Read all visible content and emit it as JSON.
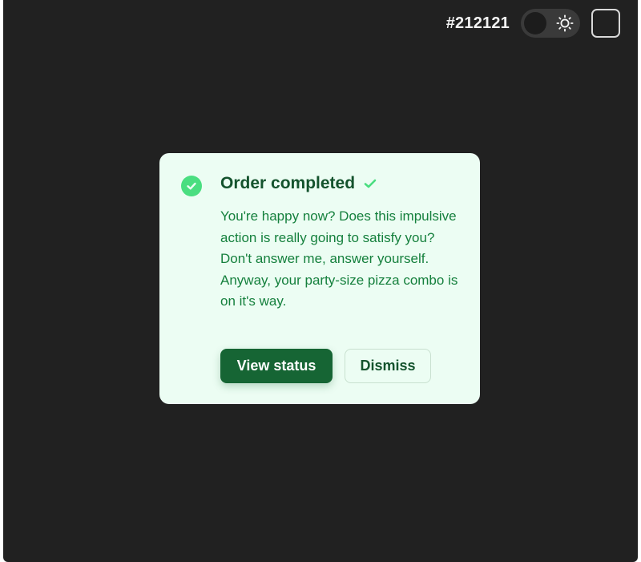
{
  "header": {
    "hex_label": "#212121",
    "toggle_icon": "sun-icon"
  },
  "toast": {
    "title": "Order completed",
    "message": "You're happy now? Does this impulsive action is really going to satisfy you? Don't answer me, answer yourself. Anyway, your party-size pizza combo is on it's way.",
    "primary_action": "View status",
    "secondary_action": "Dismiss",
    "status_icon": "check-circle-icon"
  },
  "colors": {
    "background": "#212121",
    "toast_bg": "#ecfdf3",
    "accent": "#4ade80",
    "primary_button": "#166534",
    "title_text": "#14532d",
    "body_text": "#15803d"
  }
}
